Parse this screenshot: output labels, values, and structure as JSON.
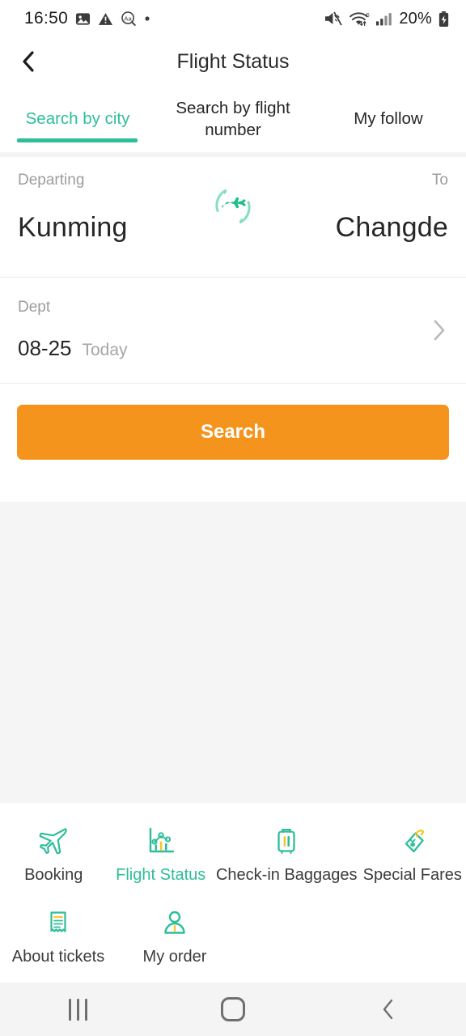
{
  "status_bar": {
    "time": "16:50",
    "left_icons": [
      "photo-icon",
      "warning-icon",
      "font-size-icon",
      "dot-icon"
    ],
    "right_icons": [
      "mute-icon",
      "wifi-6-icon",
      "signal-bars-icon"
    ],
    "battery": "20%",
    "battery_state": "charging"
  },
  "header": {
    "back_icon": "chevron-left-icon",
    "title": "Flight Status"
  },
  "tabs": {
    "items": [
      {
        "label": "Search by city",
        "active": true
      },
      {
        "label": "Search by flight number",
        "active": false
      },
      {
        "label": "My follow",
        "active": false
      }
    ]
  },
  "route": {
    "from_label": "Departing",
    "from_city": "Kunming",
    "to_label": "To",
    "to_city": "Changde",
    "swap_icon": "swap-plane-icon"
  },
  "date": {
    "label": "Dept",
    "value": "08-25",
    "relative": "Today",
    "arrow_icon": "chevron-right-icon"
  },
  "search": {
    "label": "Search"
  },
  "menu": {
    "row1": [
      {
        "label": "Booking",
        "icon": "plane-icon",
        "active": false
      },
      {
        "label": "Flight Status",
        "icon": "chart-icon",
        "active": true
      },
      {
        "label": "Check-in Baggages",
        "icon": "suitcase-icon",
        "active": false
      },
      {
        "label": "Special Fares",
        "icon": "price-tag-icon",
        "active": false
      }
    ],
    "row2": [
      {
        "label": "About tickets",
        "icon": "receipt-icon",
        "active": false
      },
      {
        "label": "My order",
        "icon": "person-icon",
        "active": false
      }
    ]
  },
  "navbar": {
    "recents_icon": "recents-icon",
    "home_icon": "home-icon",
    "back_icon": "back-icon"
  },
  "colors": {
    "accent_green": "#2EBD9A",
    "accent_orange": "#F5941D",
    "accent_yellow": "#F7C52B",
    "text_dark": "#262626",
    "text_muted": "#9d9d9d",
    "page_bg": "#f5f5f5"
  }
}
